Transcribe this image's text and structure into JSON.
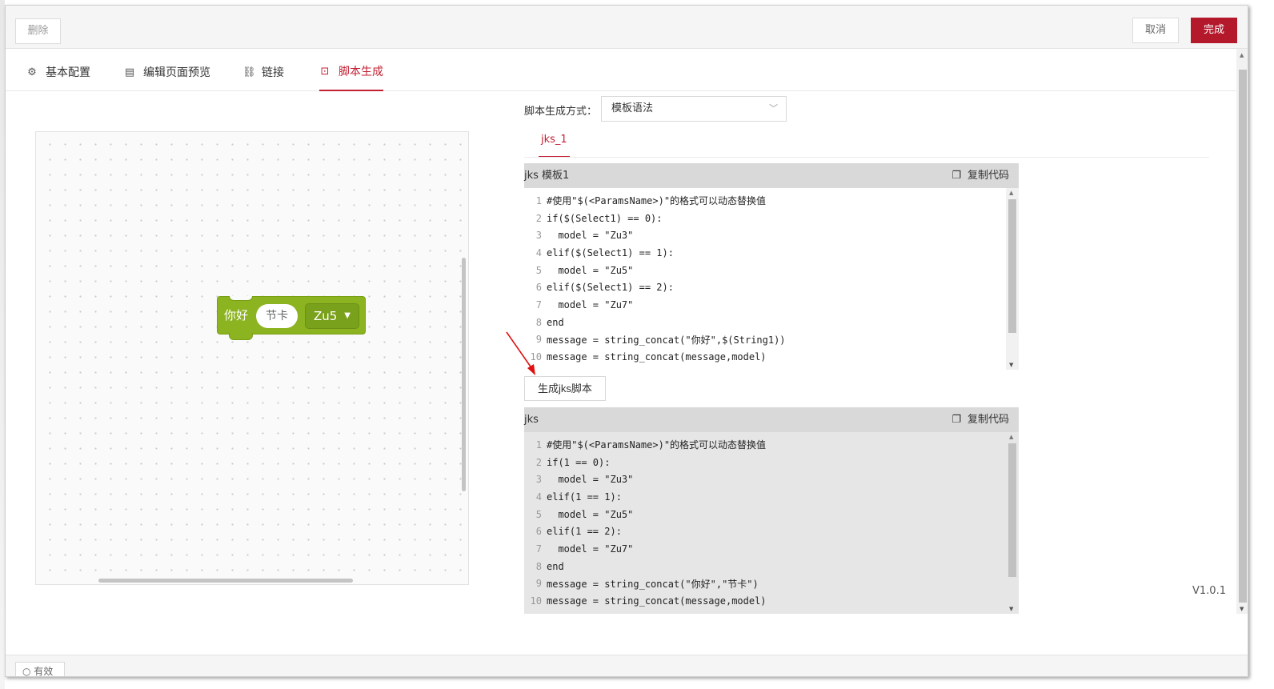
{
  "toolbar": {
    "delete_label": "删除",
    "cancel_label": "取消",
    "done_label": "完成"
  },
  "tabs": [
    {
      "label": "基本配置",
      "icon": "gear-icon",
      "active": false
    },
    {
      "label": "编辑页面预览",
      "icon": "document-icon",
      "active": false
    },
    {
      "label": "链接",
      "icon": "link-icon",
      "active": false
    },
    {
      "label": "脚本生成",
      "icon": "terminal-icon",
      "active": true
    }
  ],
  "block": {
    "label": "你好",
    "pill_value": "节卡",
    "dropdown_value": "Zu5",
    "color": "#8cb320"
  },
  "script": {
    "method_label": "脚本生成方式：",
    "method_value": "模板语法",
    "sub_tab": "jks_1",
    "template_panel": {
      "title": "jks 模板1",
      "copy_label": "复制代码",
      "lines": [
        "#使用\"$(<ParamsName>)\"的格式可以动态替换值",
        "if($(Select1) == 0):",
        "  model = \"Zu3\"",
        "elif($(Select1) == 1):",
        "  model = \"Zu5\"",
        "elif($(Select1) == 2):",
        "  model = \"Zu7\"",
        "end",
        "message = string_concat(\"你好\",$(String1))",
        "message = string_concat(message,model)"
      ]
    },
    "generate_label": "生成jks脚本",
    "output_panel": {
      "title": "jks",
      "copy_label": "复制代码",
      "lines": [
        "#使用\"$(<ParamsName>)\"的格式可以动态替换值",
        "if(1 == 0):",
        "  model = \"Zu3\"",
        "elif(1 == 1):",
        "  model = \"Zu5\"",
        "elif(1 == 2):",
        "  model = \"Zu7\"",
        "end",
        "message = string_concat(\"你好\",\"节卡\")",
        "message = string_concat(message,model)"
      ]
    }
  },
  "version": "V1.0.1",
  "footer": {
    "valid_label": "有效"
  },
  "colors": {
    "accent": "#c31f32",
    "done_button": "#b3182b"
  }
}
